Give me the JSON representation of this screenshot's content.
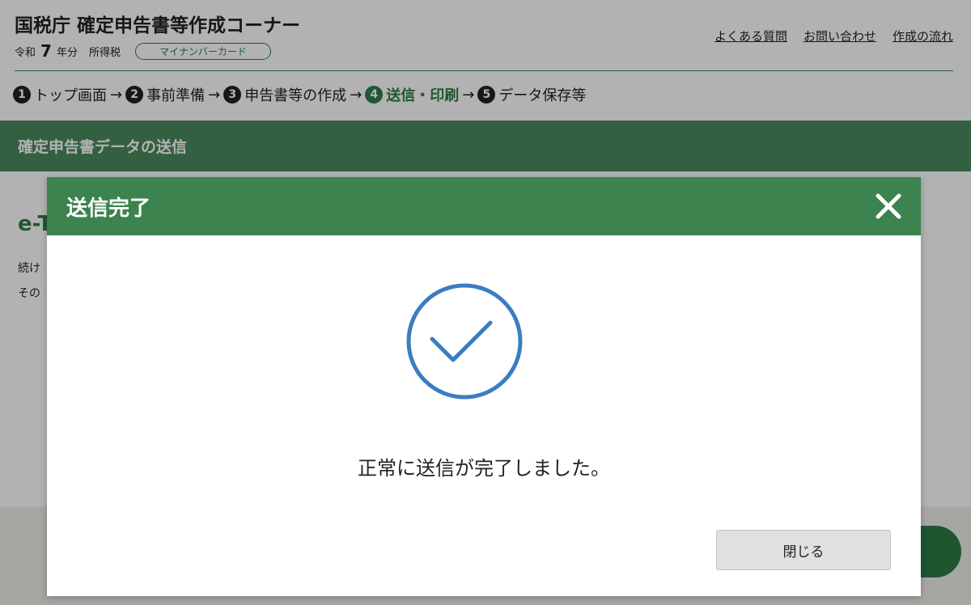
{
  "header": {
    "site_title": "国税庁 確定申告書等作成コーナー",
    "era_prefix": "令和",
    "year_number": "7",
    "year_suffix": "年分",
    "tax_type": "所得税",
    "badge": "マイナンバーカード",
    "links": [
      "よくある質問",
      "お問い合わせ",
      "作成の流れ"
    ]
  },
  "steps": [
    {
      "num": "1",
      "label": "トップ画面",
      "active": false
    },
    {
      "num": "2",
      "label": "事前準備",
      "active": false
    },
    {
      "num": "3",
      "label": "申告書等の作成",
      "active": false
    },
    {
      "num": "4",
      "label": "送信・印刷",
      "active": true
    },
    {
      "num": "5",
      "label": "データ保存等",
      "active": false
    }
  ],
  "step_arrow": "→",
  "section_title": "確定申告書データの送信",
  "background": {
    "heading_partial": "e-T",
    "text1_partial": "続け",
    "text2_partial": "その"
  },
  "modal": {
    "title": "送信完了",
    "close_icon": "close-icon",
    "status_icon": "check-circle-icon",
    "message": "正常に送信が完了しました。",
    "close_button": "閉じる"
  },
  "colors": {
    "brand_green": "#3c8350",
    "check_blue": "#3a7ebf"
  }
}
